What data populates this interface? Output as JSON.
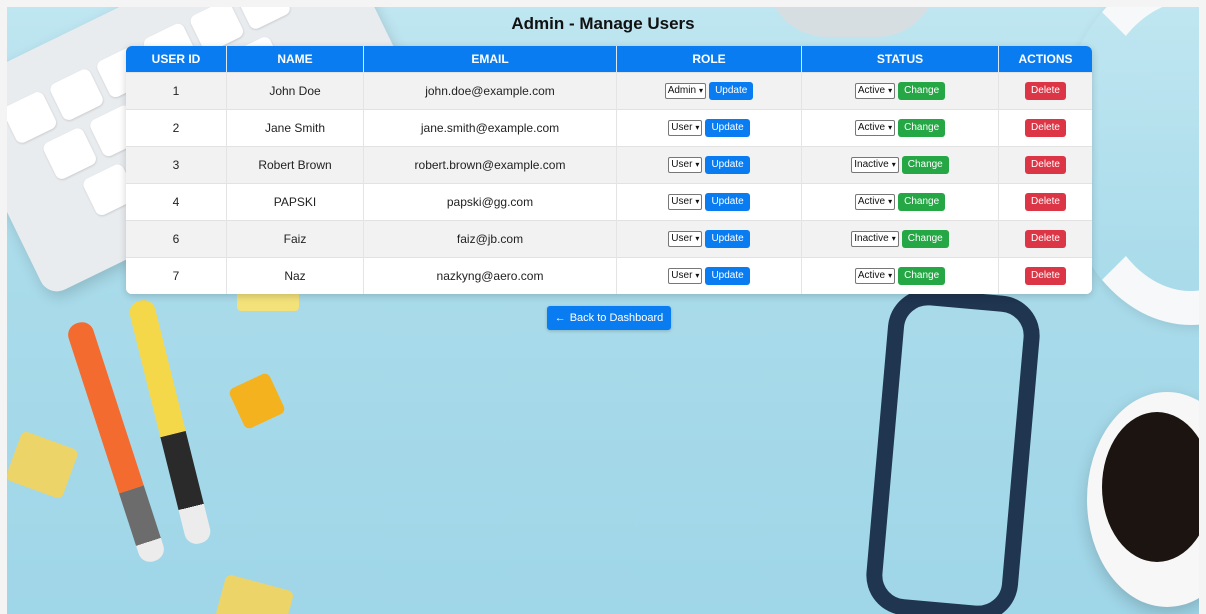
{
  "page": {
    "title": "Admin - Manage Users"
  },
  "table": {
    "headers": [
      "USER ID",
      "NAME",
      "EMAIL",
      "ROLE",
      "STATUS",
      "ACTIONS"
    ],
    "rows": [
      {
        "id": "1",
        "name": "John Doe",
        "email": "john.doe@example.com",
        "role": "Admin",
        "status": "Active"
      },
      {
        "id": "2",
        "name": "Jane Smith",
        "email": "jane.smith@example.com",
        "role": "User",
        "status": "Active"
      },
      {
        "id": "3",
        "name": "Robert Brown",
        "email": "robert.brown@example.com",
        "role": "User",
        "status": "Inactive"
      },
      {
        "id": "4",
        "name": "PAPSKI",
        "email": "papski@gg.com",
        "role": "User",
        "status": "Active"
      },
      {
        "id": "6",
        "name": "Faiz",
        "email": "faiz@jb.com",
        "role": "User",
        "status": "Inactive"
      },
      {
        "id": "7",
        "name": "Naz",
        "email": "nazkyng@aero.com",
        "role": "User",
        "status": "Active"
      }
    ]
  },
  "actions": {
    "update_label": "Update",
    "change_label": "Change",
    "delete_label": "Delete"
  },
  "back_button": {
    "label": "Back to Dashboard"
  },
  "icons": {
    "back": "arrow-left-icon",
    "dropdown": "chevron-down-icon"
  },
  "colors": {
    "primary": "#0a7cf1",
    "success": "#25a745",
    "danger": "#dc3545"
  }
}
